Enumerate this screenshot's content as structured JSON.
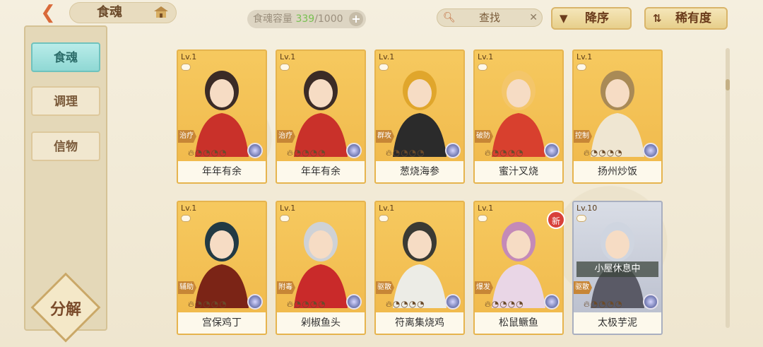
{
  "header": {
    "title": "食魂",
    "capacity_label": "食魂容量",
    "capacity_current": "339",
    "capacity_max": "/1000",
    "search_label": "查找",
    "sort_order_label": "降序",
    "sort_field_label": "稀有度"
  },
  "sidebar": {
    "tabs": [
      {
        "label": "食魂",
        "active": true
      },
      {
        "label": "调理",
        "active": false
      },
      {
        "label": "信物",
        "active": false
      }
    ],
    "decompose_label": "分解"
  },
  "cards": [
    {
      "level": "Lv.1",
      "role": "治疗",
      "name": "年年有余",
      "frame": "gold"
    },
    {
      "level": "Lv.1",
      "role": "治疗",
      "name": "年年有余",
      "frame": "gold"
    },
    {
      "level": "Lv.1",
      "role": "群攻",
      "name": "葱烧海参",
      "frame": "gold"
    },
    {
      "level": "Lv.1",
      "role": "破防",
      "name": "蜜汁叉烧",
      "frame": "gold"
    },
    {
      "level": "Lv.1",
      "role": "控制",
      "name": "扬州炒饭",
      "frame": "gold"
    },
    {
      "level": "Lv.1",
      "role": "辅助",
      "name": "宫保鸡丁",
      "frame": "gold"
    },
    {
      "level": "Lv.1",
      "role": "附毒",
      "name": "剁椒鱼头",
      "frame": "gold"
    },
    {
      "level": "Lv.1",
      "role": "驱散",
      "name": "符离集烧鸡",
      "frame": "gold"
    },
    {
      "level": "Lv.1",
      "role": "爆发",
      "name": "松鼠鳜鱼",
      "frame": "gold",
      "badge": "新"
    },
    {
      "level": "Lv.10",
      "role": "驱散",
      "name": "太极芋泥",
      "frame": "silver",
      "status": "小屋休息中"
    }
  ],
  "colors": {
    "accent_gold": "#f0b84a",
    "active_tab": "#8fd8d4",
    "capacity_green": "#78c050",
    "new_badge": "#d8403a"
  }
}
